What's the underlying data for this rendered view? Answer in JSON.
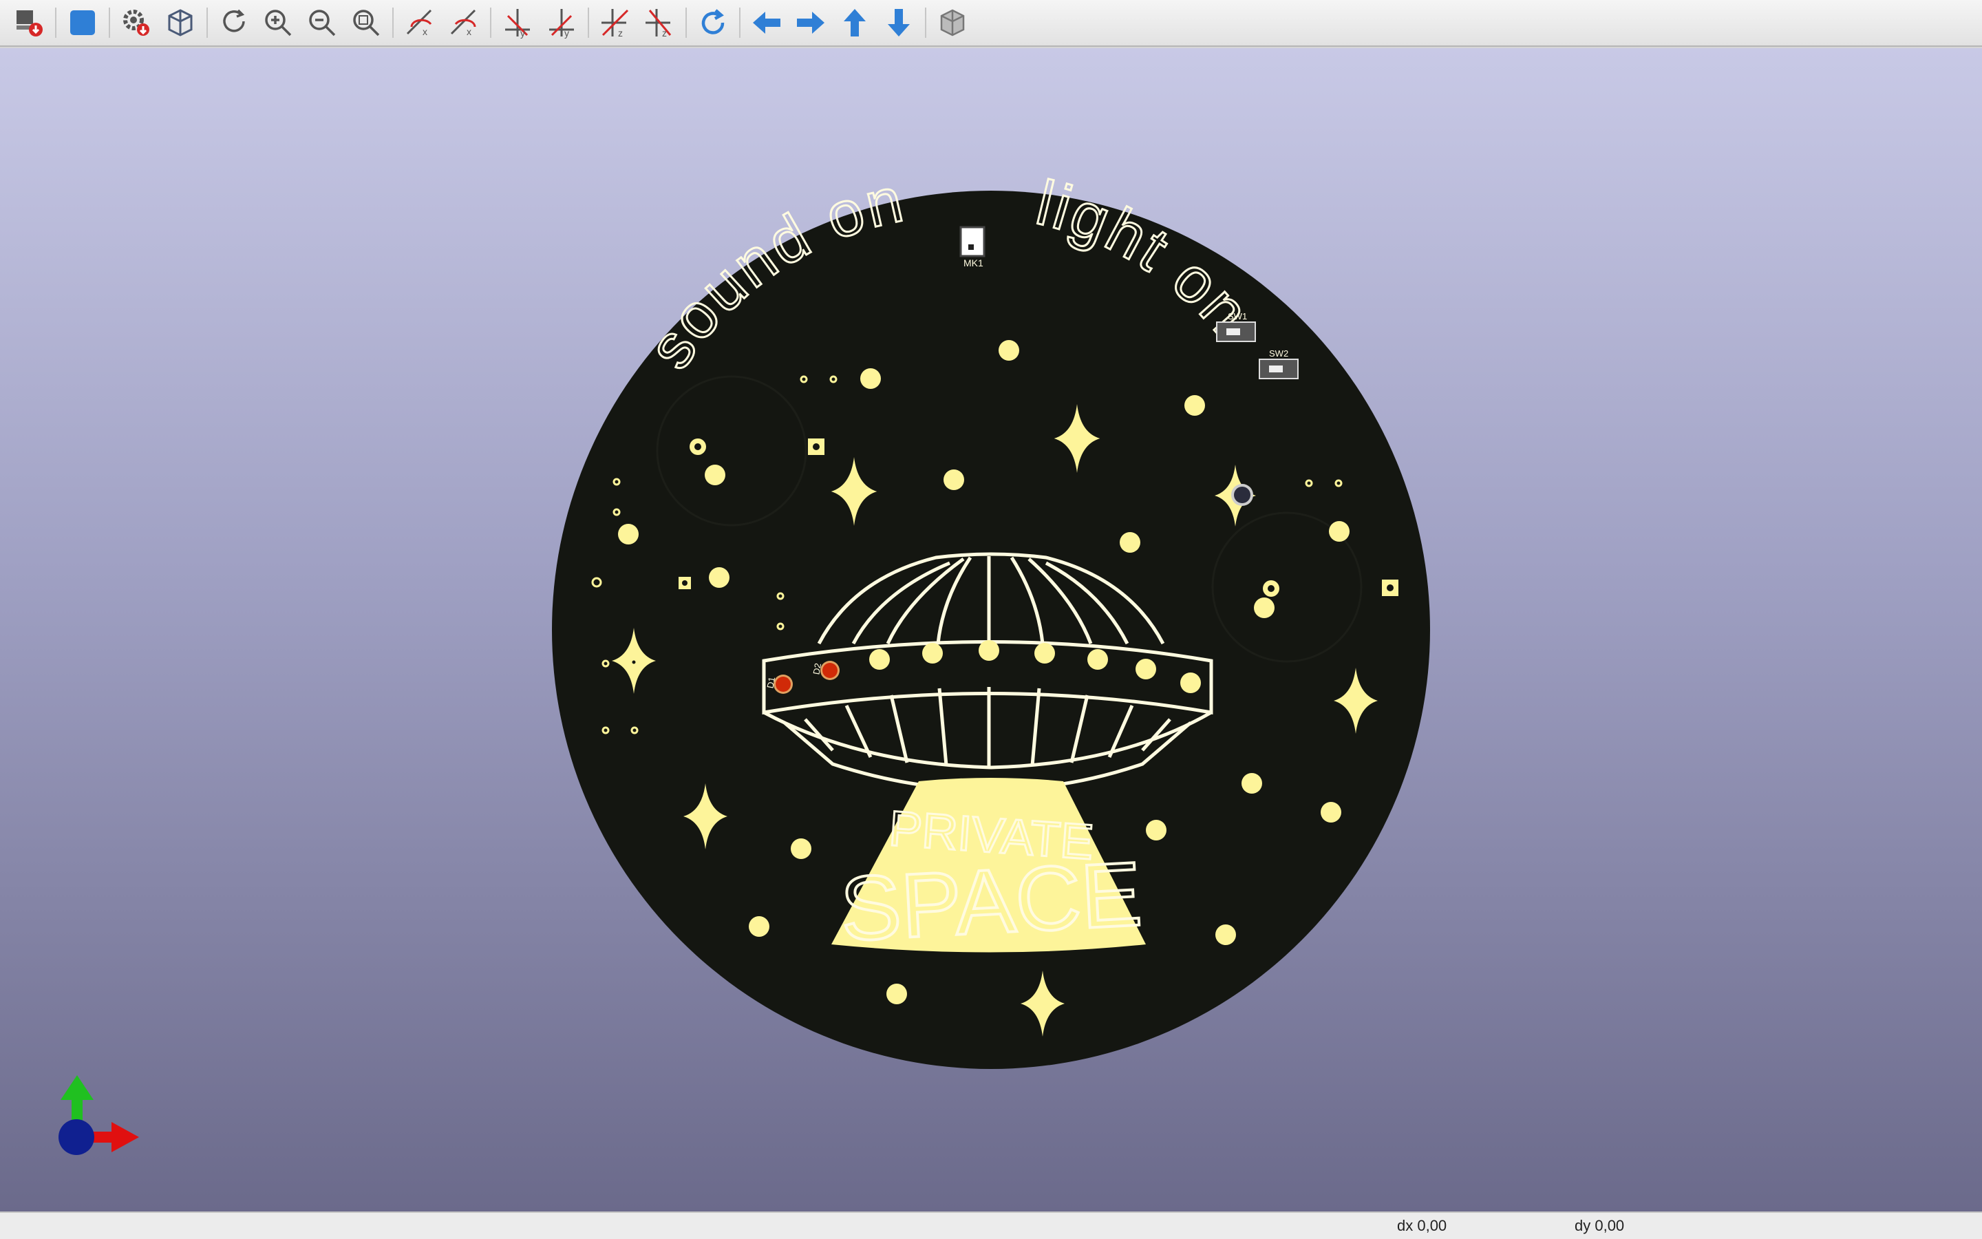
{
  "toolbar": {
    "buttons": [
      {
        "name": "export-image-button",
        "icon": "export-icon",
        "tooltip": ""
      },
      {
        "name": "toggle-render-button",
        "icon": "cube-solid-icon",
        "tooltip": ""
      },
      {
        "name": "preferences-button",
        "icon": "gear-icon",
        "tooltip": ""
      },
      {
        "name": "view-3d-button",
        "icon": "cube-outline-icon",
        "tooltip": ""
      },
      {
        "name": "reload-button",
        "icon": "refresh-icon",
        "tooltip": ""
      },
      {
        "name": "zoom-in-button",
        "icon": "zoom-in-icon",
        "tooltip": ""
      },
      {
        "name": "zoom-out-button",
        "icon": "zoom-out-icon",
        "tooltip": ""
      },
      {
        "name": "zoom-fit-button",
        "icon": "zoom-fit-icon",
        "tooltip": ""
      },
      {
        "name": "rotate-x-cw-button",
        "icon": "rotate-x-cw-icon",
        "tooltip": ""
      },
      {
        "name": "rotate-x-ccw-button",
        "icon": "rotate-x-ccw-icon",
        "tooltip": ""
      },
      {
        "name": "rotate-y-cw-button",
        "icon": "rotate-y-cw-icon",
        "tooltip": ""
      },
      {
        "name": "rotate-y-ccw-button",
        "icon": "rotate-y-ccw-icon",
        "tooltip": ""
      },
      {
        "name": "rotate-z-cw-button",
        "icon": "rotate-z-cw-icon",
        "tooltip": ""
      },
      {
        "name": "rotate-z-ccw-button",
        "icon": "rotate-z-ccw-icon",
        "tooltip": ""
      },
      {
        "name": "flip-board-button",
        "icon": "flip-icon",
        "tooltip": ""
      },
      {
        "name": "move-left-button",
        "icon": "arrow-left-icon",
        "tooltip": ""
      },
      {
        "name": "move-right-button",
        "icon": "arrow-right-icon",
        "tooltip": ""
      },
      {
        "name": "move-up-button",
        "icon": "arrow-up-icon",
        "tooltip": ""
      },
      {
        "name": "move-down-button",
        "icon": "arrow-down-icon",
        "tooltip": ""
      },
      {
        "name": "ortho-view-button",
        "icon": "cube-gray-icon",
        "tooltip": ""
      }
    ]
  },
  "board": {
    "text_sound": "sound on",
    "text_light": "light on",
    "text_private": "PRIVATE",
    "text_space": "SPACE",
    "labels": {
      "mk1": "MK1",
      "sw1": "SW1",
      "sw2": "SW2",
      "d1": "D1",
      "d2": "D2"
    }
  },
  "statusbar": {
    "dx": "dx 0,00",
    "dy": "dy 0,00"
  },
  "colors": {
    "board": "#141611",
    "silk": "#fffbe0",
    "pad": "#fdf49a",
    "axis_x": "#e01010",
    "axis_y": "#20c020",
    "axis_z": "#102090",
    "accent": "#2f7fd6"
  }
}
